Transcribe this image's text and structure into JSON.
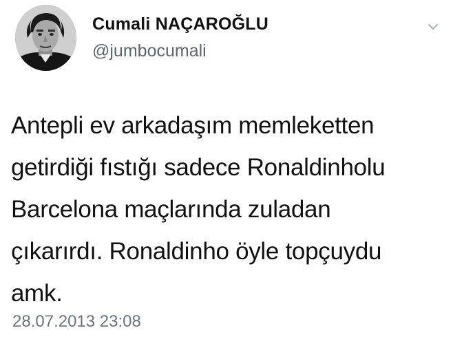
{
  "tweet": {
    "author": {
      "display_name": "Cumali NAÇAROĞLU",
      "handle": "@jumbocumali",
      "avatar_icon": "profile-photo-icon"
    },
    "menu_icon": "chevron-down-icon",
    "text_lines": [
      "Antepli ev arkadaşım memleketten",
      "getirdiği fıstığı sadece Ronaldinholu",
      "Barcelona maçlarında zuladan",
      "çıkarırdı. Ronaldinho öyle topçuydu",
      "amk."
    ],
    "timestamp": "28.07.2013 23:08"
  },
  "colors": {
    "background": "#ffffff",
    "text": "#111111",
    "secondary_text": "#5b6670",
    "caret": "#a7b0b8"
  }
}
